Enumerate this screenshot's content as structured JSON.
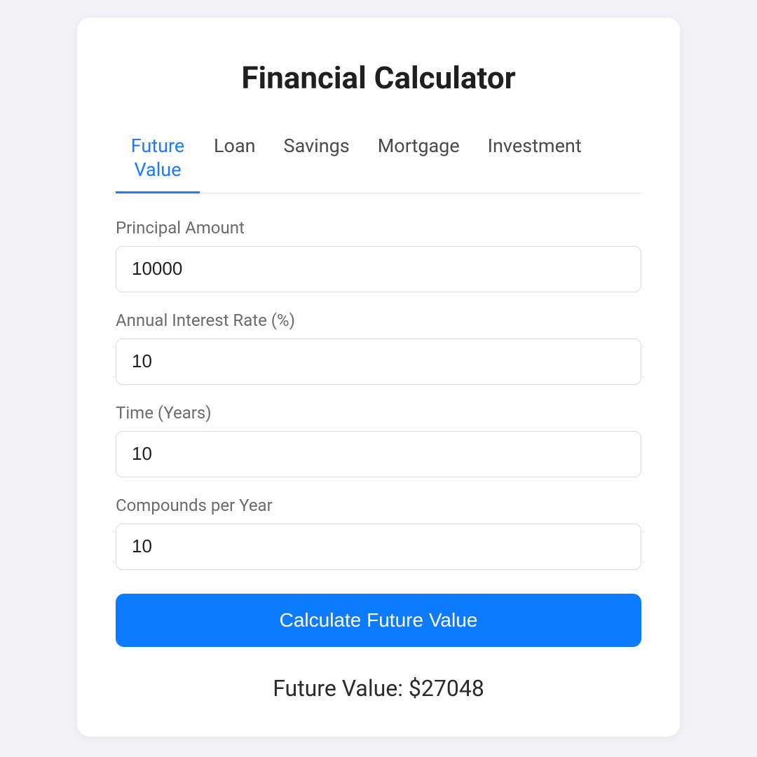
{
  "title": "Financial Calculator",
  "tabs": {
    "future_value": "Future Value",
    "loan": "Loan",
    "savings": "Savings",
    "mortgage": "Mortgage",
    "investment": "Investment"
  },
  "form": {
    "principal_label": "Principal Amount",
    "principal_value": "10000",
    "rate_label": "Annual Interest Rate (%)",
    "rate_value": "10",
    "time_label": "Time (Years)",
    "time_value": "10",
    "compounds_label": "Compounds per Year",
    "compounds_value": "10"
  },
  "button_label": "Calculate Future Value",
  "result_text": "Future Value: $27048",
  "colors": {
    "accent": "#0d7bff",
    "tab_active": "#1d7bff"
  }
}
